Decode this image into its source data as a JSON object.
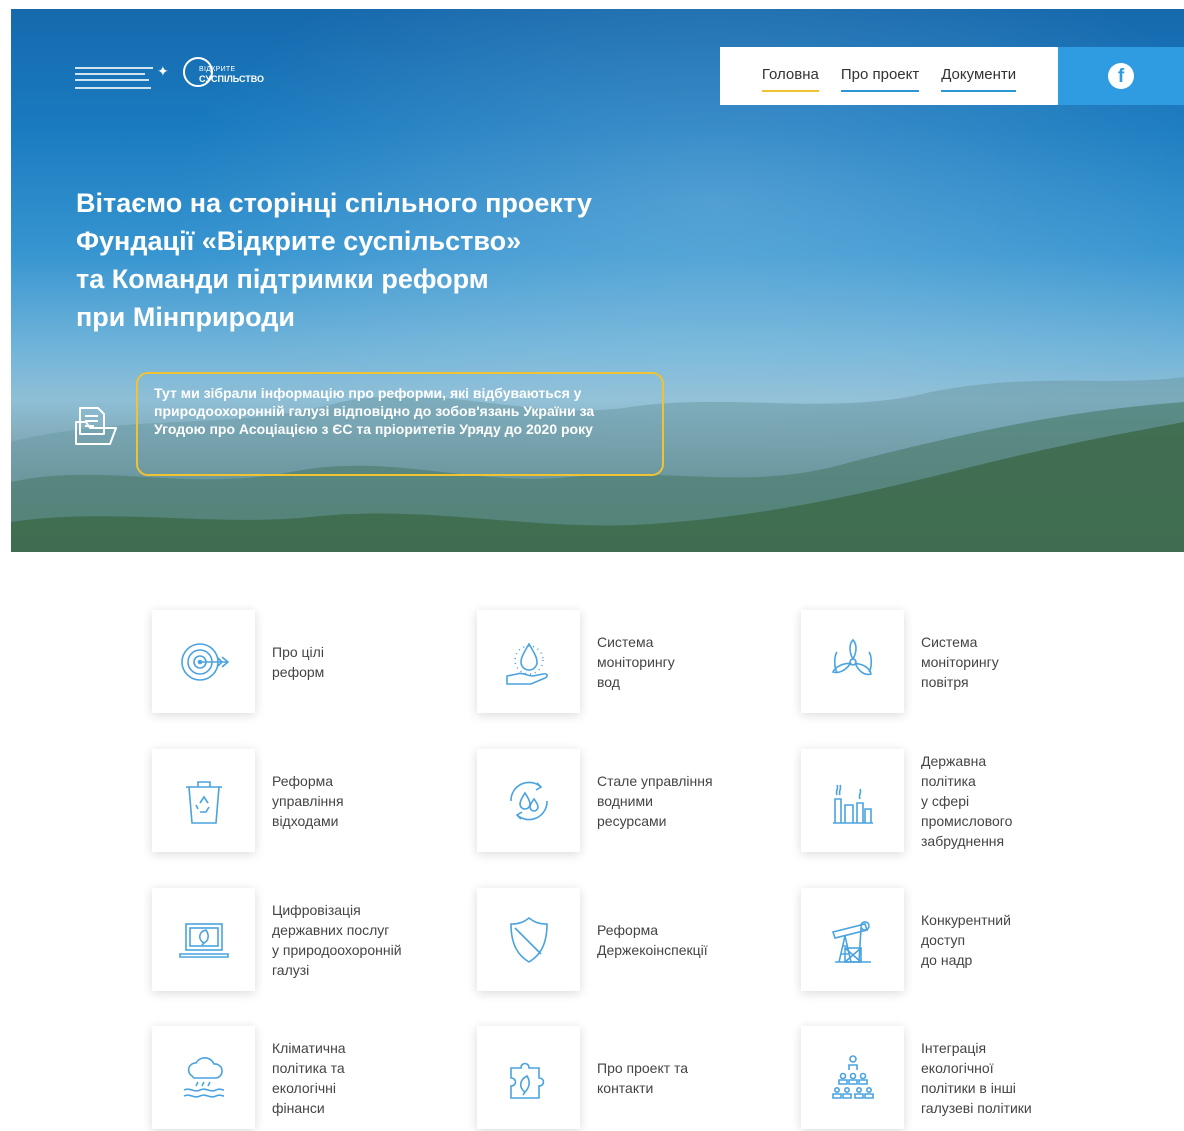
{
  "logos": {
    "ministry_alt": "Міністерство екології та природних ресурсів України — Команда Підтримки Реформ",
    "osf_line1": "ВІДКРИТЕ",
    "osf_line2": "СУСПІЛЬСТВО"
  },
  "nav": {
    "items": [
      {
        "label": "Головна",
        "active": true
      },
      {
        "label": "Про проект",
        "active": false
      },
      {
        "label": "Документи",
        "active": false
      }
    ],
    "facebook_icon": "facebook-icon"
  },
  "hero": {
    "title_lines": [
      "Вітаємо на сторінці спільного проекту",
      "Фундації «Відкрите суспільство»",
      "та Команди підтримки реформ",
      "при Мінприроди"
    ],
    "callout": "Тут ми зібрали інформацію про реформи, які відбуваються у природоохоронній галузі відповідно до зобов'язань України за Угодою про Асоціацією з ЄС та пріоритетів Уряду до 2020 року"
  },
  "colors": {
    "accent_blue": "#2f95d6",
    "accent_yellow": "#f1c232",
    "icon_blue": "#4aa3df"
  },
  "cards": [
    {
      "label": "Про цілі\nреформ",
      "icon": "target-icon"
    },
    {
      "label": "Система\nмоніторингу\nвод",
      "icon": "water-drop-hand-icon"
    },
    {
      "label": "Система\nмоніторингу\nповітря",
      "icon": "fan-icon"
    },
    {
      "label": "Реформа\nуправління\nвідходами",
      "icon": "recycle-bin-icon"
    },
    {
      "label": "Стале управління\nводними\nресурсами",
      "icon": "water-cycle-icon"
    },
    {
      "label": "Державна\nполітика\nу сфері\nпромислового\nзабруднення",
      "icon": "factory-icon"
    },
    {
      "label": "Цифровізація\nдержавних послуг\nу природоохоронній\nгалузі",
      "icon": "laptop-leaf-icon"
    },
    {
      "label": "Реформа\nДержекоінспекції",
      "icon": "shield-icon"
    },
    {
      "label": "Конкурентний\nдоступ\nдо надр",
      "icon": "oil-pump-icon"
    },
    {
      "label": "Кліматична\nполітика та\nекологічні\nфінанси",
      "icon": "cloud-rain-icon"
    },
    {
      "label": "Про проект та\nконтакти",
      "icon": "puzzle-icon"
    },
    {
      "label": "Інтеграція\nекологічної\nполітики в інші\nгалузеві політики",
      "icon": "hierarchy-icon"
    }
  ]
}
